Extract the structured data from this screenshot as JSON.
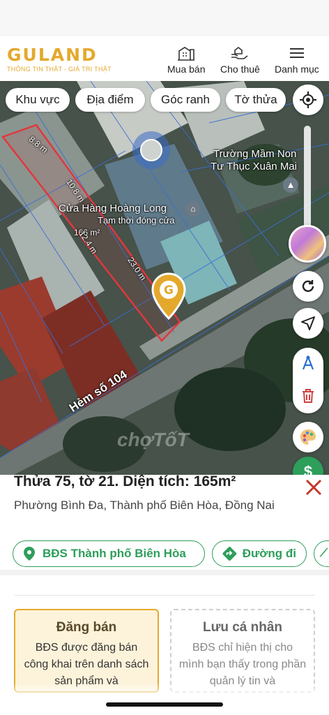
{
  "brand": {
    "name": "GULAND",
    "tagline": "THÔNG TIN THẬT - GIÁ TRỊ THẬT",
    "accent": "#e4a92c"
  },
  "nav": [
    {
      "label": "Mua bán",
      "icon": "building-icon"
    },
    {
      "label": "Cho thuê",
      "icon": "hand-house-icon"
    },
    {
      "label": "Danh mục",
      "icon": "menu-icon"
    }
  ],
  "filters": [
    "Khu vực",
    "Địa điểm",
    "Góc ranh",
    "Tờ thửa"
  ],
  "map": {
    "labels": {
      "school_line1": "Trường Mầm Non",
      "school_line2": "Tư Thục Xuân Mai",
      "shop": "Cửa Hàng Hoàng Long",
      "shop_status": "Tạm thời đóng cửa",
      "street": "Hẻm số 104",
      "watermark": "chợTốT"
    },
    "dimensions": {
      "top": "8.8 m",
      "side_left": "10.8 m",
      "area": "166 m²",
      "inner": "12.4 m",
      "side_right": "23.0 m"
    },
    "colors": {
      "parcel": "#e0383d",
      "pin": "#e4a92c",
      "grid": "#3a6fd6"
    }
  },
  "parcel": {
    "title": "Thửa 75, tờ 21. Diện tích: 165m²",
    "address": "Phường Bình Đa, Thành phố Biên Hòa, Đồng Nai",
    "actions": [
      {
        "label": "BĐS Thành phố Biên Hòa",
        "icon": "map-pin-icon"
      },
      {
        "label": "Đường đi",
        "icon": "directions-icon"
      }
    ]
  },
  "cards": [
    {
      "title": "Đăng bán",
      "desc": "BĐS được đăng bán công khai trên danh sách sản phẩm và"
    },
    {
      "title": "Lưu cá nhân",
      "desc": "BĐS chỉ hiện thị cho mình bạn thấy trong phần quản lý tin và"
    }
  ],
  "colors": {
    "green": "#2e9e5b",
    "close": "#c0392b",
    "card_highlight": "#fdf3da"
  }
}
